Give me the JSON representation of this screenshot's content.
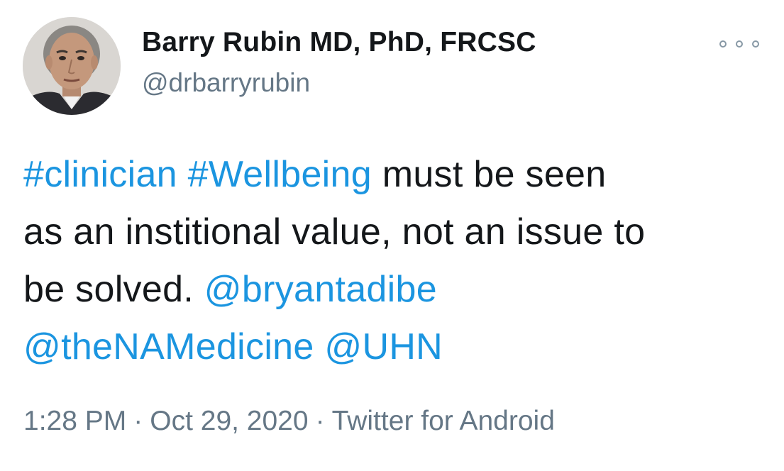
{
  "author": {
    "name": "Barry Rubin MD, PhD, FRCSC",
    "handle": "@drbarryrubin",
    "avatar_icon": "profile-photo-icon"
  },
  "tweet": {
    "line1": {
      "hashtag1": "#clinician",
      "hashtag2": "#Wellbeing",
      "text": "must be seen"
    },
    "line2": {
      "text": "as an institional value, not an issue to"
    },
    "line3": {
      "text": "be solved.",
      "mention1": "@bryantadibe"
    },
    "line4": {
      "mention2": "@theNAMedicine",
      "mention3": "@UHN"
    }
  },
  "meta": {
    "time": "1:28 PM",
    "separator": "·",
    "date": "Oct 29, 2020",
    "source": "Twitter for Android"
  },
  "more_menu_icon": "more-options-icon",
  "colors": {
    "link": "#1b95e0",
    "text": "#14171a",
    "secondary": "#657786"
  }
}
